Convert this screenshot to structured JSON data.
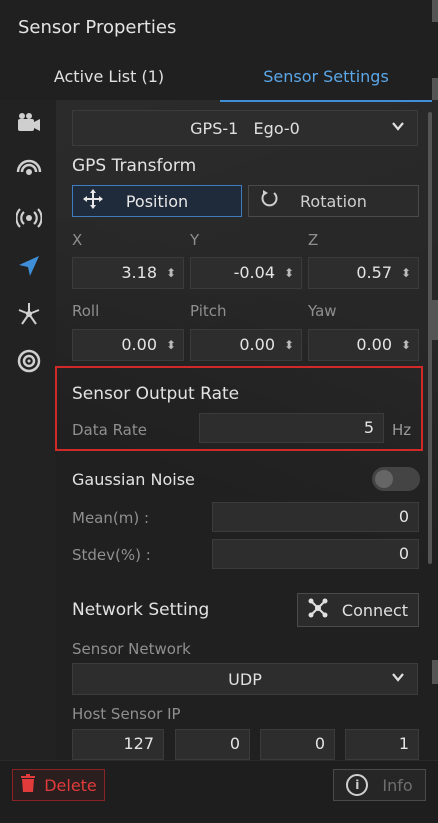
{
  "panel": {
    "title": "Sensor Properties"
  },
  "tabs": [
    {
      "label": "Active List  (1)"
    },
    {
      "label": "Sensor Settings"
    }
  ],
  "sidebar": {
    "icons": [
      "camera-icon",
      "radar-icon",
      "broadcast-icon",
      "gps-arrow-icon",
      "network-node-icon",
      "target-icon"
    ],
    "active": "gps-arrow-icon"
  },
  "sensor_select": {
    "value": "GPS-1   Ego-0"
  },
  "gps_transform": {
    "title": "GPS Transform",
    "position_label": "Position",
    "rotation_label": "Rotation",
    "x_label": "X",
    "y_label": "Y",
    "z_label": "Z",
    "x": "3.18",
    "y": "-0.04",
    "z": "0.57",
    "roll_label": "Roll",
    "pitch_label": "Pitch",
    "yaw_label": "Yaw",
    "roll": "0.00",
    "pitch": "0.00",
    "yaw": "0.00"
  },
  "output_rate": {
    "title": "Sensor Output Rate",
    "label": "Data Rate",
    "value": "5",
    "unit": "Hz"
  },
  "noise": {
    "title": "Gaussian Noise",
    "enabled": false,
    "mean_label": "Mean(m) :",
    "mean": "0",
    "stdev_label": "Stdev(%) :",
    "stdev": "0"
  },
  "network": {
    "title": "Network Setting",
    "connect_label": "Connect",
    "sensor_network_label": "Sensor Network",
    "sensor_network": "UDP",
    "host_ip_label": "Host Sensor IP",
    "ip": [
      "127",
      "0",
      "0",
      "1"
    ]
  },
  "footer": {
    "delete_label": "Delete",
    "info_label": "Info"
  },
  "colors": {
    "accent": "#3f8fd8",
    "danger": "#e23b3b",
    "highlight": "#d12828"
  }
}
